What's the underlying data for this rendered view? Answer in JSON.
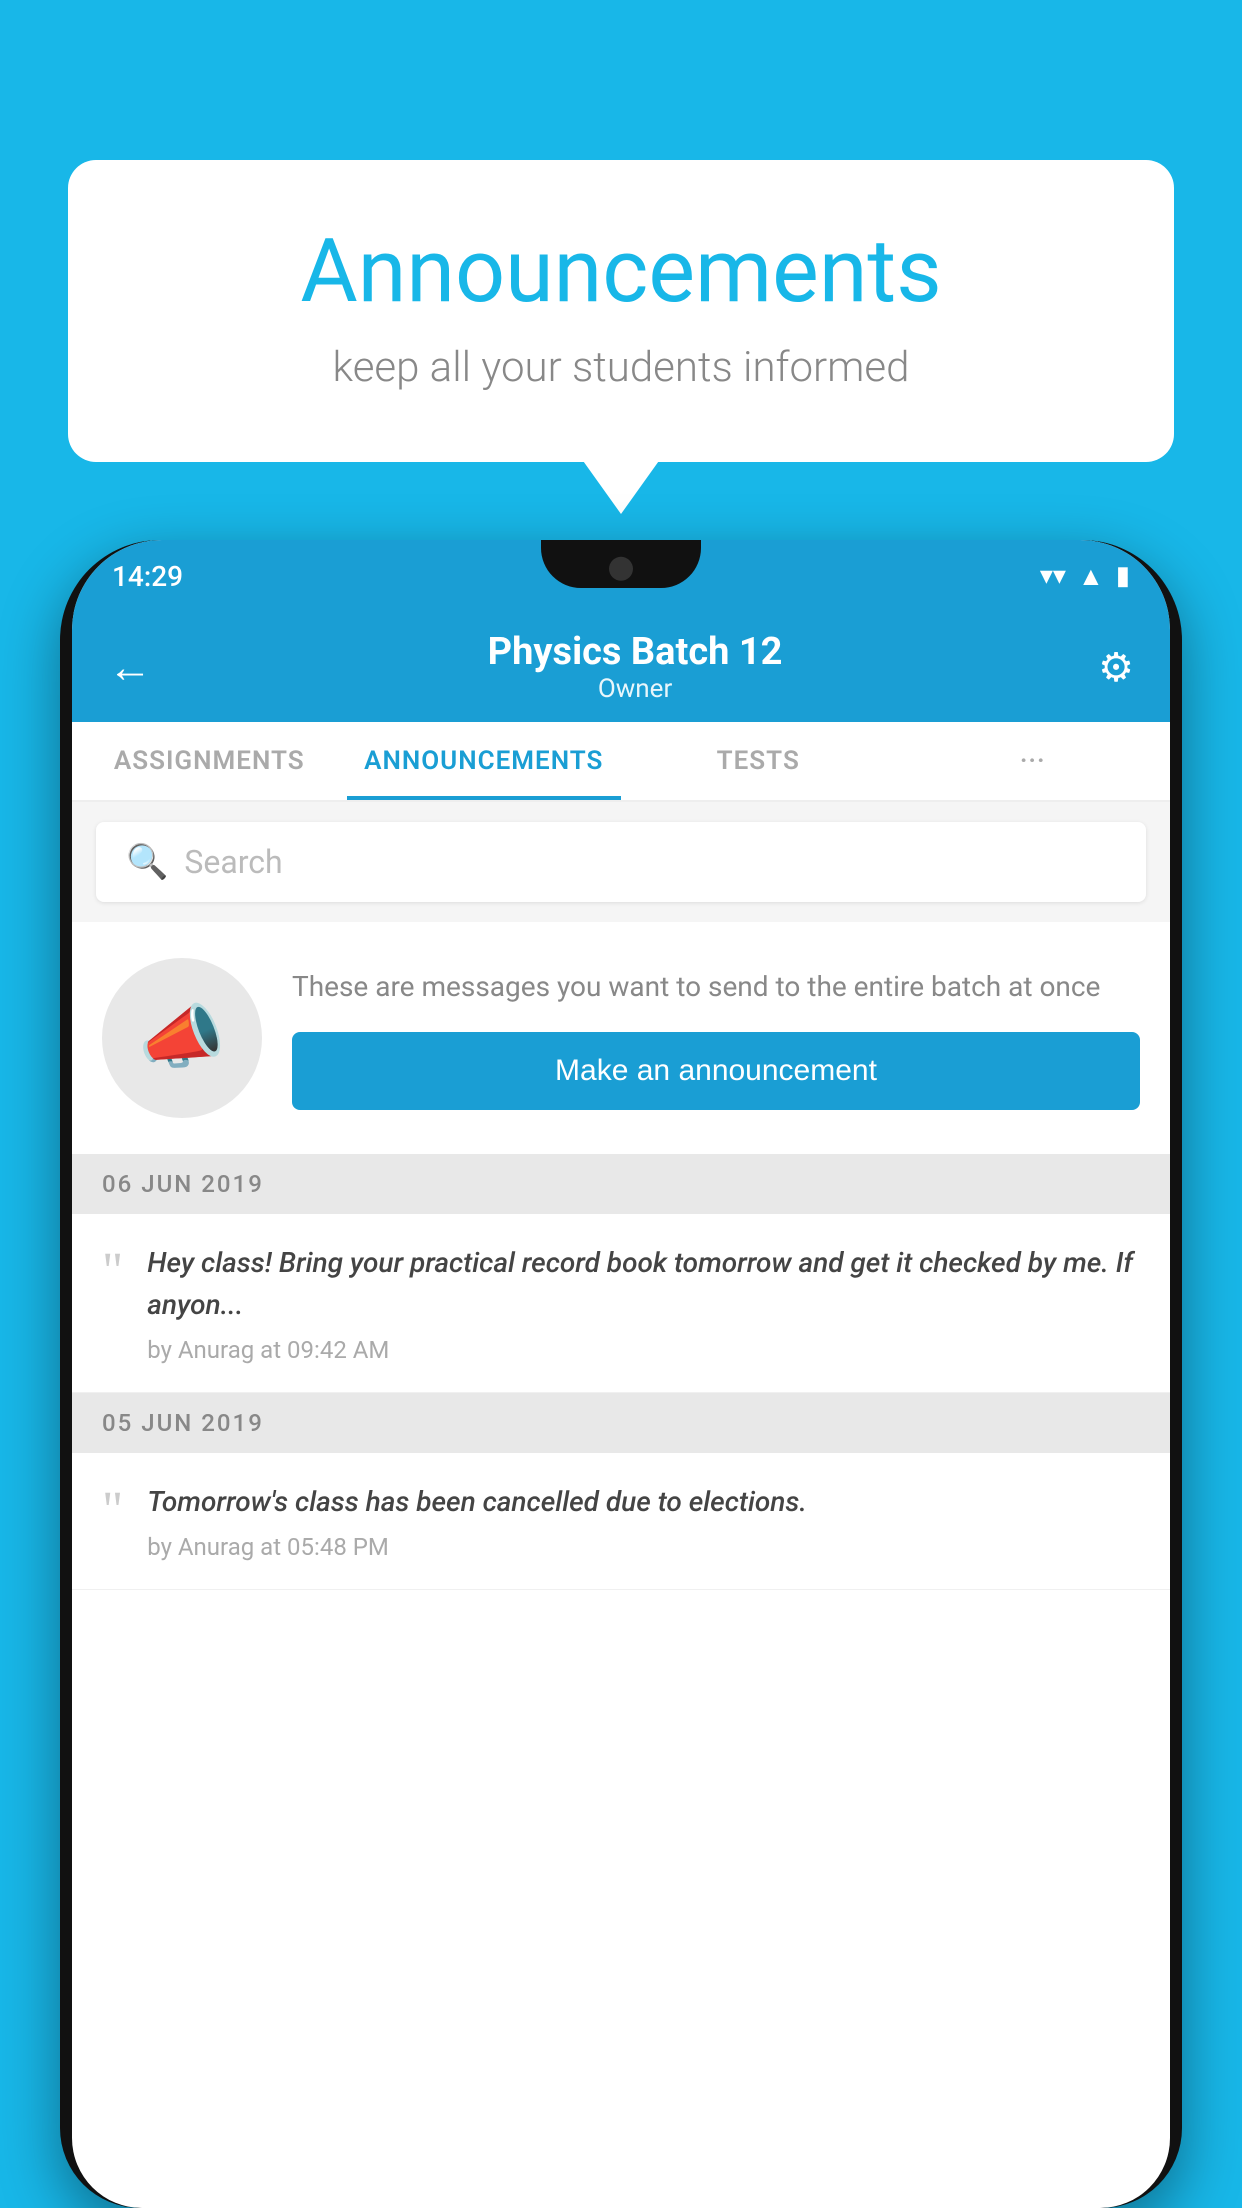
{
  "background_color": "#18B7E8",
  "speech_bubble": {
    "title": "Announcements",
    "subtitle": "keep all your students informed"
  },
  "phone": {
    "status_bar": {
      "time": "14:29",
      "icons": [
        "wifi",
        "signal",
        "battery"
      ]
    },
    "app_bar": {
      "title": "Physics Batch 12",
      "subtitle": "Owner",
      "back_label": "←",
      "settings_label": "⚙"
    },
    "tabs": [
      {
        "label": "ASSIGNMENTS",
        "active": false
      },
      {
        "label": "ANNOUNCEMENTS",
        "active": true
      },
      {
        "label": "TESTS",
        "active": false
      },
      {
        "label": "···",
        "active": false
      }
    ],
    "search": {
      "placeholder": "Search",
      "icon": "🔍"
    },
    "promo": {
      "description": "These are messages you want to send to the entire batch at once",
      "button_label": "Make an announcement"
    },
    "announcements": [
      {
        "date": "06  JUN  2019",
        "text": "Hey class! Bring your practical record book tomorrow and get it checked by me. If anyon...",
        "author": "by Anurag at 09:42 AM"
      },
      {
        "date": "05  JUN  2019",
        "text": "Tomorrow's class has been cancelled due to elections.",
        "author": "by Anurag at 05:48 PM"
      }
    ]
  }
}
